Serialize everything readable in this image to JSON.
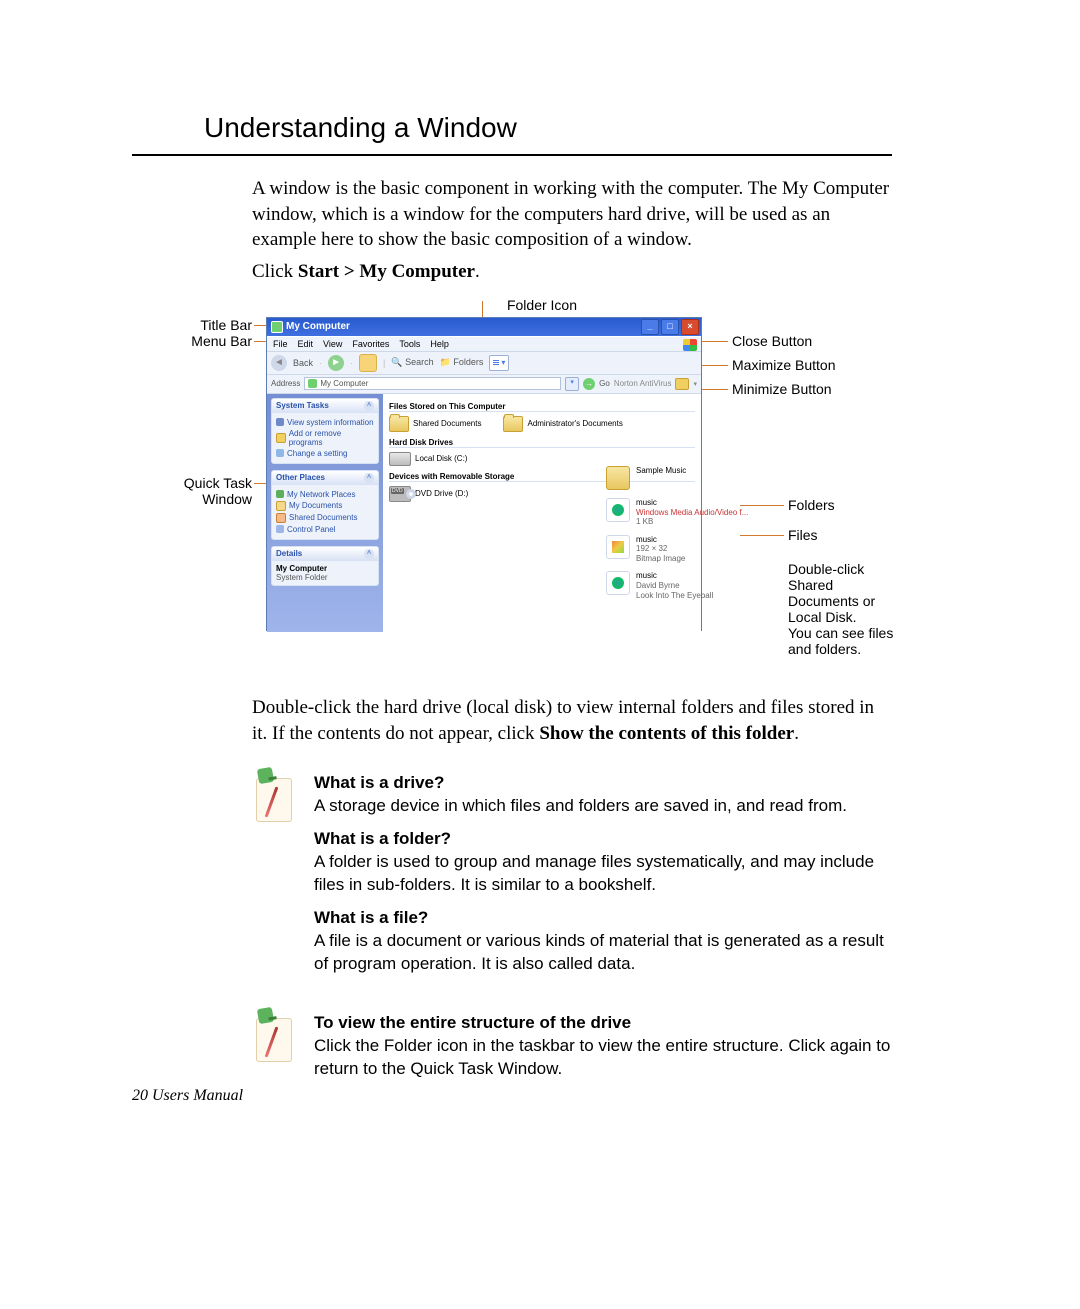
{
  "title": "Understanding a Window",
  "intro": "A window is the basic component in working with the computer. The My Computer window, which is a window for the computers hard drive, will be used as an example here to show the basic composition of a window.",
  "click_prefix": "Click ",
  "click_bold": "Start > My Computer",
  "click_suffix": ".",
  "folder_icon_label": "Folder Icon",
  "callouts": {
    "title_bar": "Title Bar",
    "menu_bar": "Menu Bar",
    "close": "Close Button",
    "maximize": "Maximize Button",
    "minimize": "Minimize Button",
    "quick_task": "Quick Task\nWindow",
    "folders": "Folders",
    "files": "Files",
    "dbl": "Double-click\nShared\nDocuments or\nLocal Disk.\nYou can see files\nand folders."
  },
  "window": {
    "title": "My Computer",
    "menus": [
      "File",
      "Edit",
      "View",
      "Favorites",
      "Tools",
      "Help"
    ],
    "toolbar": {
      "back": "Back",
      "search": "Search",
      "folders": "Folders"
    },
    "address": {
      "label": "Address",
      "value": "My Computer",
      "go": "Go",
      "norton": "Norton AntiVirus"
    },
    "sidebar": {
      "system_tasks": {
        "title": "System Tasks",
        "items": [
          "View system information",
          "Add or remove programs",
          "Change a setting"
        ]
      },
      "other_places": {
        "title": "Other Places",
        "items": [
          "My Network Places",
          "My Documents",
          "Shared Documents",
          "Control Panel"
        ]
      },
      "details": {
        "title": "Details",
        "name": "My Computer",
        "type": "System Folder"
      }
    },
    "main": {
      "g1": "Files Stored on This Computer",
      "g1_items": [
        "Shared Documents",
        "Administrator's Documents"
      ],
      "g2": "Hard Disk Drives",
      "g2_items": [
        "Local Disk (C:)"
      ],
      "g3": "Devices with Removable Storage",
      "g3_items": [
        "DVD Drive (D:)"
      ],
      "dvd_tag": "DVD"
    },
    "right_items": [
      {
        "name": "Sample Music",
        "sub": "",
        "type": "folder"
      },
      {
        "name": "music",
        "sub": "Windows Media Audio/Video f...",
        "sub2": "1 KB",
        "type": "wma",
        "red": true
      },
      {
        "name": "music",
        "sub": "192 × 32",
        "sub2": "Bitmap Image",
        "type": "bmp"
      },
      {
        "name": "music",
        "sub": "David Byrne",
        "sub2": "Look Into The Eyeball",
        "type": "wma"
      }
    ]
  },
  "para2_a": "Double-click the hard drive (local disk) to view internal folders and files stored in it. If the contents do not appear, click ",
  "para2_b": "Show the contents of this folder",
  "para2_c": ".",
  "notes": [
    {
      "q1": "What is a drive?",
      "a1": "A storage device in which files and folders are saved in, and read from.",
      "q2": "What is a folder?",
      "a2": "A folder is used to group and manage files systematically, and may include files in sub-folders. It is similar to a bookshelf.",
      "q3": "What is a file?",
      "a3": "A file is a document or various kinds of material that is generated as a result of program operation. It is also called data."
    },
    {
      "q1": "To view the entire structure of the drive",
      "a1": "Click the Folder icon in the taskbar to view the entire structure. Click again to return to the Quick Task Window."
    }
  ],
  "footer": "20  Users Manual"
}
